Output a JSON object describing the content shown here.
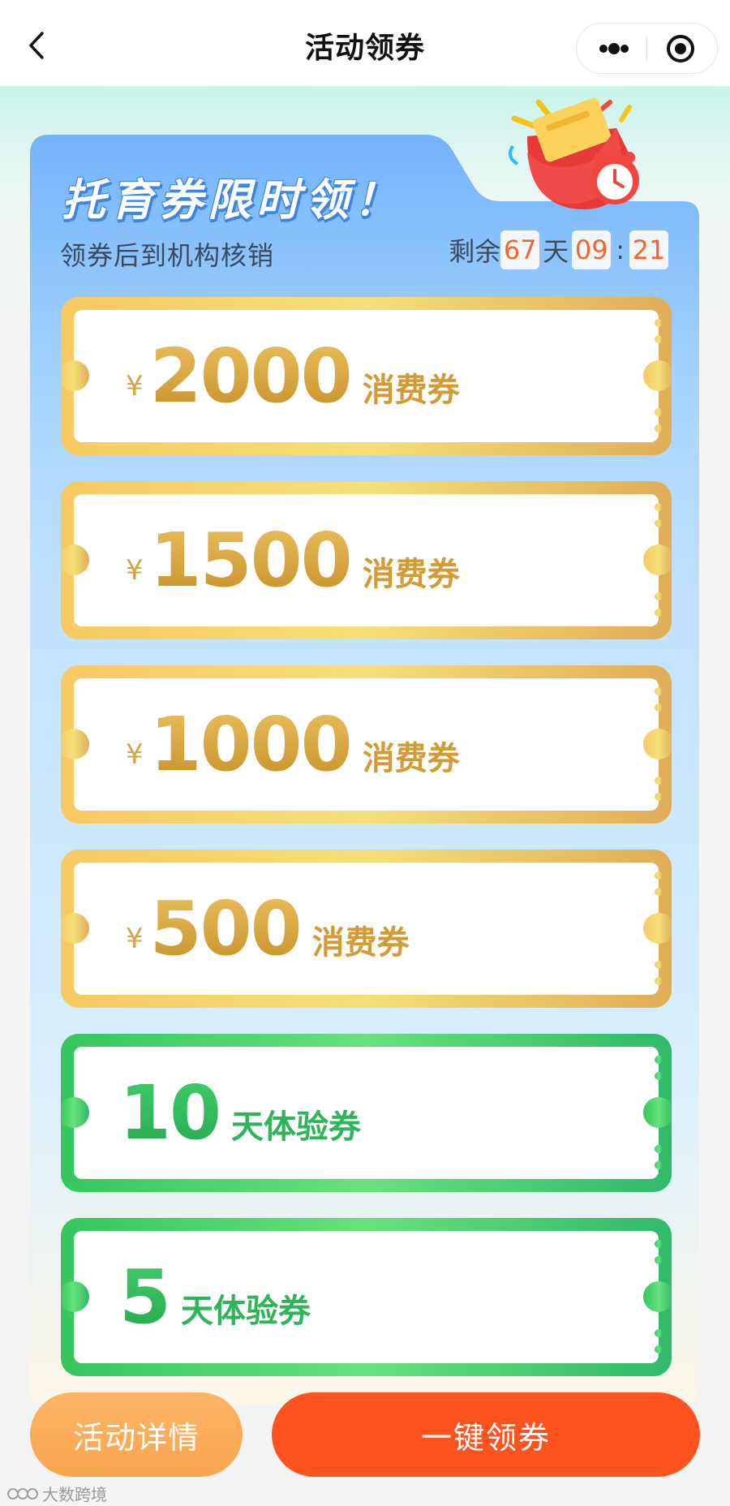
{
  "nav": {
    "title": "活动领券"
  },
  "hero": {
    "title": "托育券限时领！",
    "subtitle": "领券后到机构核销"
  },
  "countdown": {
    "prefix": "剩余",
    "days": "67",
    "day_unit": "天",
    "hours": "09",
    "sep": ":",
    "minutes": "21"
  },
  "coupons": [
    {
      "currency": "¥",
      "amount": "2000",
      "unit": "消费券"
    },
    {
      "currency": "¥",
      "amount": "1500",
      "unit": "消费券"
    },
    {
      "currency": "¥",
      "amount": "1000",
      "unit": "消费券"
    },
    {
      "currency": "¥",
      "amount": "500",
      "unit": "消费券"
    },
    {
      "amount": "10",
      "unit": "天体验券"
    },
    {
      "amount": "5",
      "unit": "天体验券"
    }
  ],
  "buttons": {
    "details": "活动详情",
    "claim_all": "一键领券"
  },
  "watermark": "大数跨境",
  "colors": {
    "gold": "#d29b33",
    "green": "#34be5f",
    "claim": "#fd541f",
    "details": "#f9a54e",
    "panel_top": "#74b5fb"
  }
}
